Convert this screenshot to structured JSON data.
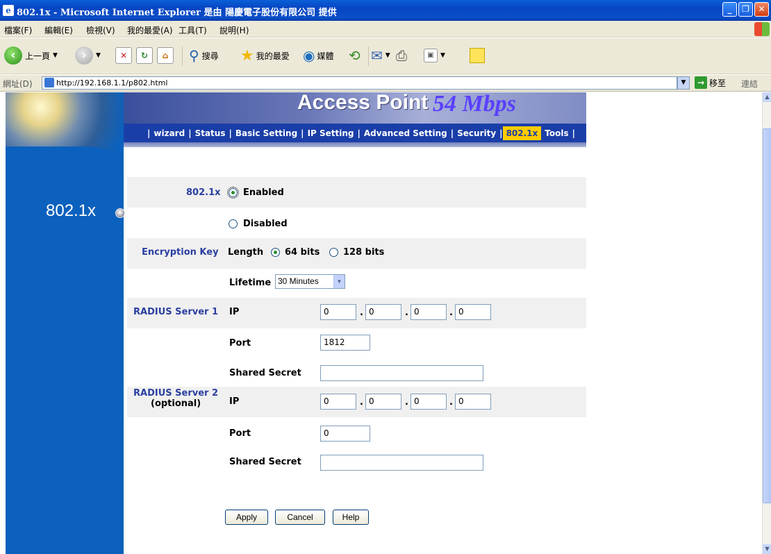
{
  "window": {
    "title": "802.1x - Microsoft Internet Explorer 是由 陽慶電子股份有限公司 提供",
    "minimize_glyph": "_",
    "maximize_glyph": "❐",
    "close_glyph": "✕"
  },
  "menubar": {
    "items": [
      "檔案(F)",
      "編輯(E)",
      "檢視(V)",
      "我的最愛(A)",
      "工具(T)",
      "說明(H)"
    ]
  },
  "toolbar": {
    "back_label": "上一頁",
    "search_label": "搜尋",
    "favorites_label": "我的最愛",
    "media_label": "媒體"
  },
  "addressbar": {
    "label": "網址(D)",
    "url": "http://192.168.1.1/p802.html",
    "go_label": "移至",
    "links_label": "連結"
  },
  "page": {
    "brand": "Access Point",
    "speed": "54 Mbps",
    "side_title": "802.1x",
    "nav": [
      "wizard",
      "Status",
      "Basic  Setting",
      "IP Setting",
      "Advanced Setting",
      "Security",
      "802.1x",
      "Tools"
    ],
    "active_nav": "802.1x",
    "form": {
      "dot1x_label": "802.1x",
      "enabled_label": "Enabled",
      "disabled_label": "Disabled",
      "dot1x_value": "Enabled",
      "enc_key_label": "Encryption Key",
      "length_label": "Length",
      "len64_label": "64 bits",
      "len128_label": "128 bits",
      "length_value": "64 bits",
      "lifetime_label": "Lifetime",
      "lifetime_value": "30 Minutes",
      "radius1_label": "RADIUS Server 1",
      "ip_label": "IP",
      "radius1_ip": [
        "0",
        "0",
        "0",
        "0"
      ],
      "port_label": "Port",
      "radius1_port": "1812",
      "shared_secret_label": "Shared Secret",
      "radius1_secret": "",
      "radius2_label": "RADIUS Server 2",
      "radius2_optional": "(optional)",
      "radius2_ip": [
        "0",
        "0",
        "0",
        "0"
      ],
      "radius2_port": "0",
      "radius2_secret": "",
      "apply_label": "Apply",
      "cancel_label": "Cancel",
      "help_label": "Help"
    }
  }
}
